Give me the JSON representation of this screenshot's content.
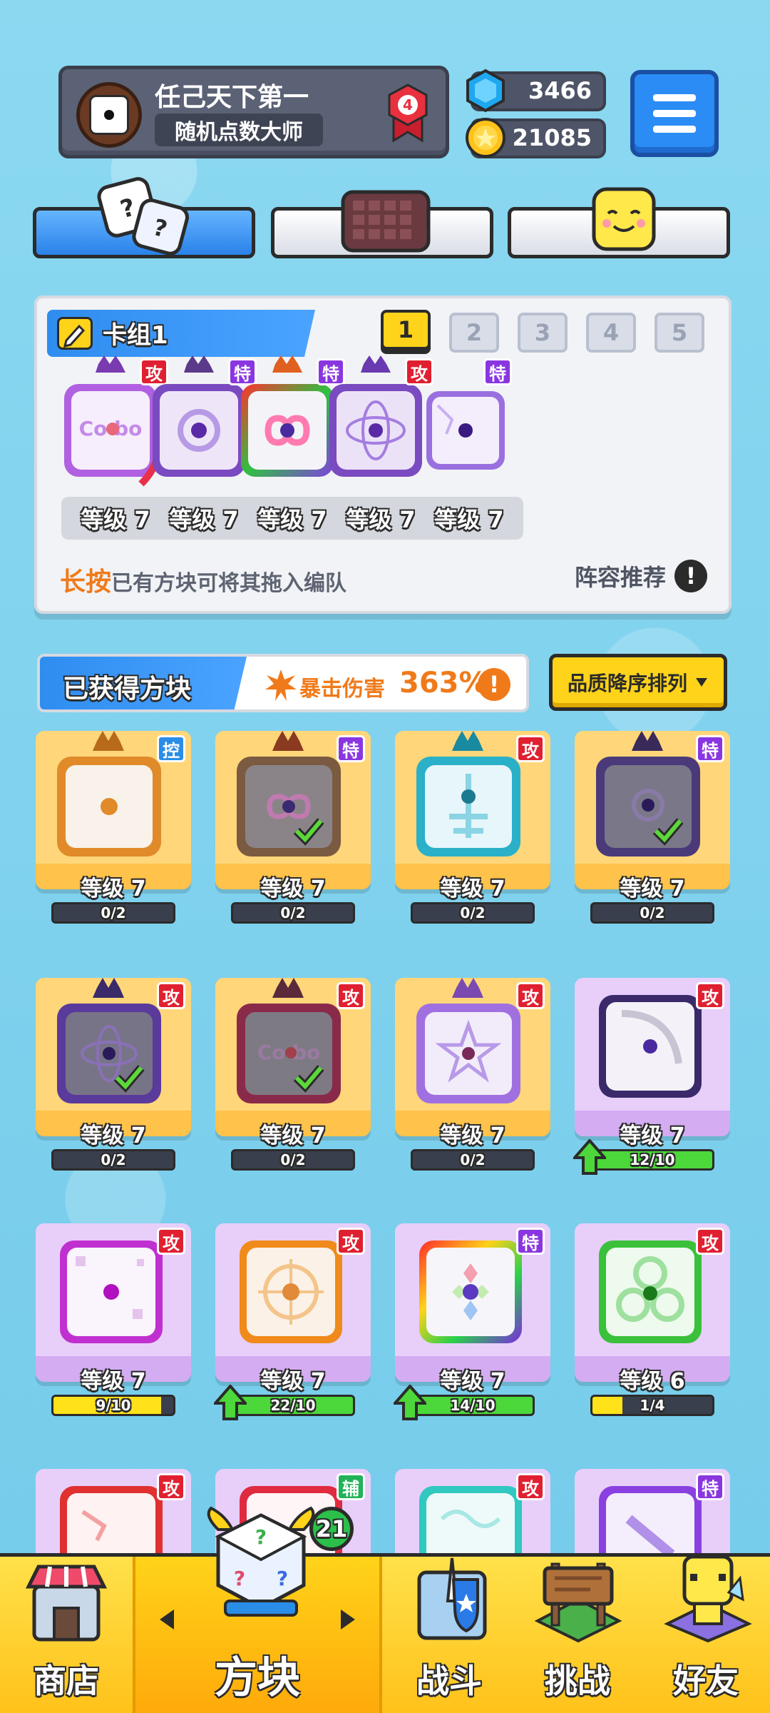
{
  "player": {
    "name": "任己天下第一",
    "title": "随机点数大师",
    "rank": "4"
  },
  "currency": {
    "gems": "3466",
    "coins": "21085"
  },
  "deck": {
    "title": "卡组1",
    "numbers": [
      "1",
      "2",
      "3",
      "4",
      "5"
    ],
    "active": 1,
    "cards": [
      {
        "tag": "攻",
        "level": "等级 7"
      },
      {
        "tag": "特",
        "level": "等级 7"
      },
      {
        "tag": "特",
        "level": "等级 7"
      },
      {
        "tag": "攻",
        "level": "等级 7"
      },
      {
        "tag": "特",
        "level": "等级 7"
      }
    ],
    "hint_highlight": "长按",
    "hint_text": "已有方块可将其拖入编队",
    "recommend": "阵容推荐",
    "recommend_icon": "!"
  },
  "owned": {
    "title": "已获得方块",
    "crit_label": "暴击伤害",
    "crit_value": "363%",
    "info_icon": "!",
    "sort_label": "品质降序排列",
    "cards": [
      {
        "tag": "控",
        "level": "等级 7",
        "progress": "0/2",
        "ratio": 0
      },
      {
        "tag": "特",
        "level": "等级 7",
        "progress": "0/2",
        "ratio": 0
      },
      {
        "tag": "攻",
        "level": "等级 7",
        "progress": "0/2",
        "ratio": 0
      },
      {
        "tag": "特",
        "level": "等级 7",
        "progress": "0/2",
        "ratio": 0
      },
      {
        "tag": "攻",
        "level": "等级 7",
        "progress": "0/2",
        "ratio": 0
      },
      {
        "tag": "攻",
        "level": "等级 7",
        "progress": "0/2",
        "ratio": 0
      },
      {
        "tag": "攻",
        "level": "等级 7",
        "progress": "0/2",
        "ratio": 0
      },
      {
        "tag": "攻",
        "level": "等级 7",
        "progress": "12/10",
        "ratio": 1
      },
      {
        "tag": "攻",
        "level": "等级 7",
        "progress": "9/10",
        "ratio": 0.9
      },
      {
        "tag": "攻",
        "level": "等级 7",
        "progress": "22/10",
        "ratio": 1
      },
      {
        "tag": "特",
        "level": "等级 7",
        "progress": "14/10",
        "ratio": 1
      },
      {
        "tag": "攻",
        "level": "等级 6",
        "progress": "1/4",
        "ratio": 0.25
      },
      {
        "tag": "攻"
      },
      {
        "tag": "辅"
      },
      {
        "tag": "攻"
      },
      {
        "tag": "特"
      }
    ]
  },
  "nav": {
    "shop": "商店",
    "dice": "方块",
    "dice_badge": "21",
    "battle": "战斗",
    "challenge": "挑战",
    "friends": "好友"
  },
  "colors": {
    "gold_card": "#ffc24a",
    "purple_card": "#d4acf2",
    "attack_tag": "#e02030",
    "special_tag": "#8a36e0",
    "control_tag": "#2a8de8",
    "support_tag": "#21b35a",
    "accent_blue": "#2f8df0",
    "accent_yellow": "#ffd31a",
    "progress_green": "#4cd83a",
    "progress_yellow": "#ffe21a"
  }
}
